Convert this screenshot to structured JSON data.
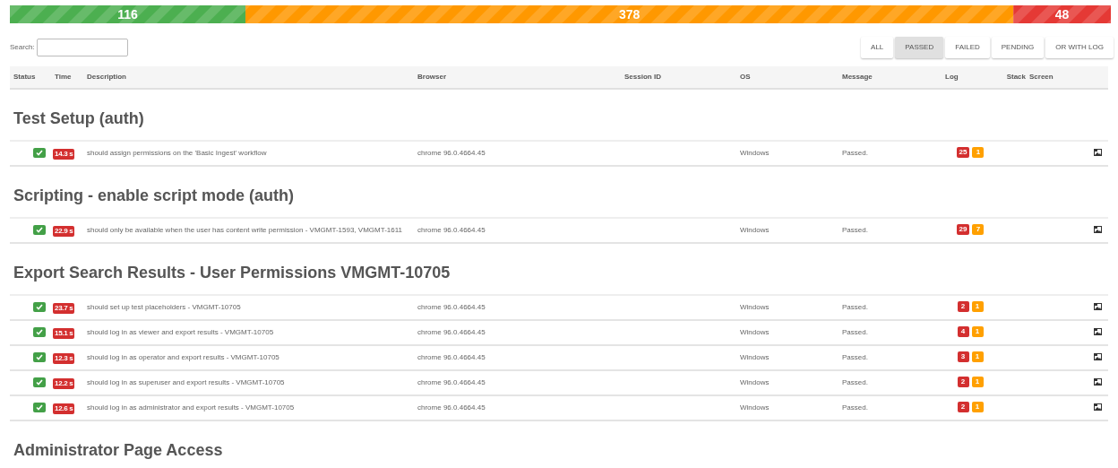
{
  "summary_bar": {
    "chart_data": {
      "type": "bar",
      "orientation": "horizontal",
      "stacked": true,
      "data_labels": true,
      "series": [
        {
          "color": "#4caf50",
          "values": [
            116
          ]
        },
        {
          "color": "#ff9800",
          "values": [
            378
          ]
        },
        {
          "color": "#e53935",
          "values": [
            48
          ]
        }
      ]
    }
  },
  "search": {
    "label": "Search:"
  },
  "filters": [
    {
      "label": "ALL",
      "selected": false
    },
    {
      "label": "PASSED",
      "selected": true
    },
    {
      "label": "FAILED",
      "selected": false
    },
    {
      "label": "PENDING",
      "selected": false
    },
    {
      "label": "OR WITH LOG",
      "selected": false
    }
  ],
  "table": {
    "columns": [
      "Status",
      "Time",
      "Description",
      "Browser",
      "Session ID",
      "OS",
      "Message",
      "Log",
      "Stack",
      "Screen"
    ],
    "groups": [
      {
        "title": "Test Setup (auth)",
        "rows": [
          {
            "passed": true,
            "time": "14.3 s",
            "description": "should assign permissions on the 'Basic Ingest' workflow",
            "browser": "chrome 96.0.4664.45",
            "os": "Windows",
            "message": "Passed.",
            "log_errors": "25",
            "log_warnings": "1"
          }
        ]
      },
      {
        "title": "Scripting - enable script mode (auth)",
        "rows": [
          {
            "passed": true,
            "time": "22.9 s",
            "description": "should only be available when the user has content write permission - VMGMT-1593, VMGMT-1611",
            "browser": "chrome 96.0.4664.45",
            "os": "Windows",
            "message": "Passed.",
            "log_errors": "29",
            "log_warnings": "7"
          }
        ]
      },
      {
        "title": "Export Search Results - User Permissions VMGMT-10705",
        "rows": [
          {
            "passed": true,
            "time": "23.7 s",
            "description": "should set up test placeholders - VMGMT-10705",
            "browser": "chrome 96.0.4664.45",
            "os": "Windows",
            "message": "Passed.",
            "log_errors": "2",
            "log_warnings": "1"
          },
          {
            "passed": true,
            "time": "15.1 s",
            "description": "should log in as viewer and export results - VMGMT-10705",
            "browser": "chrome 96.0.4664.45",
            "os": "Windows",
            "message": "Passed.",
            "log_errors": "4",
            "log_warnings": "1"
          },
          {
            "passed": true,
            "time": "12.3 s",
            "description": "should log in as operator and export results - VMGMT-10705",
            "browser": "chrome 96.0.4664.45",
            "os": "Windows",
            "message": "Passed.",
            "log_errors": "3",
            "log_warnings": "1"
          },
          {
            "passed": true,
            "time": "12.2 s",
            "description": "should log in as superuser and export results - VMGMT-10705",
            "browser": "chrome 96.0.4664.45",
            "os": "Windows",
            "message": "Passed.",
            "log_errors": "2",
            "log_warnings": "1"
          },
          {
            "passed": true,
            "time": "12.6 s",
            "description": "should log in as administrator and export results - VMGMT-10705",
            "browser": "chrome 96.0.4664.45",
            "os": "Windows",
            "message": "Passed.",
            "log_errors": "2",
            "log_warnings": "1"
          }
        ]
      },
      {
        "title": "Administrator Page Access"
      }
    ]
  }
}
